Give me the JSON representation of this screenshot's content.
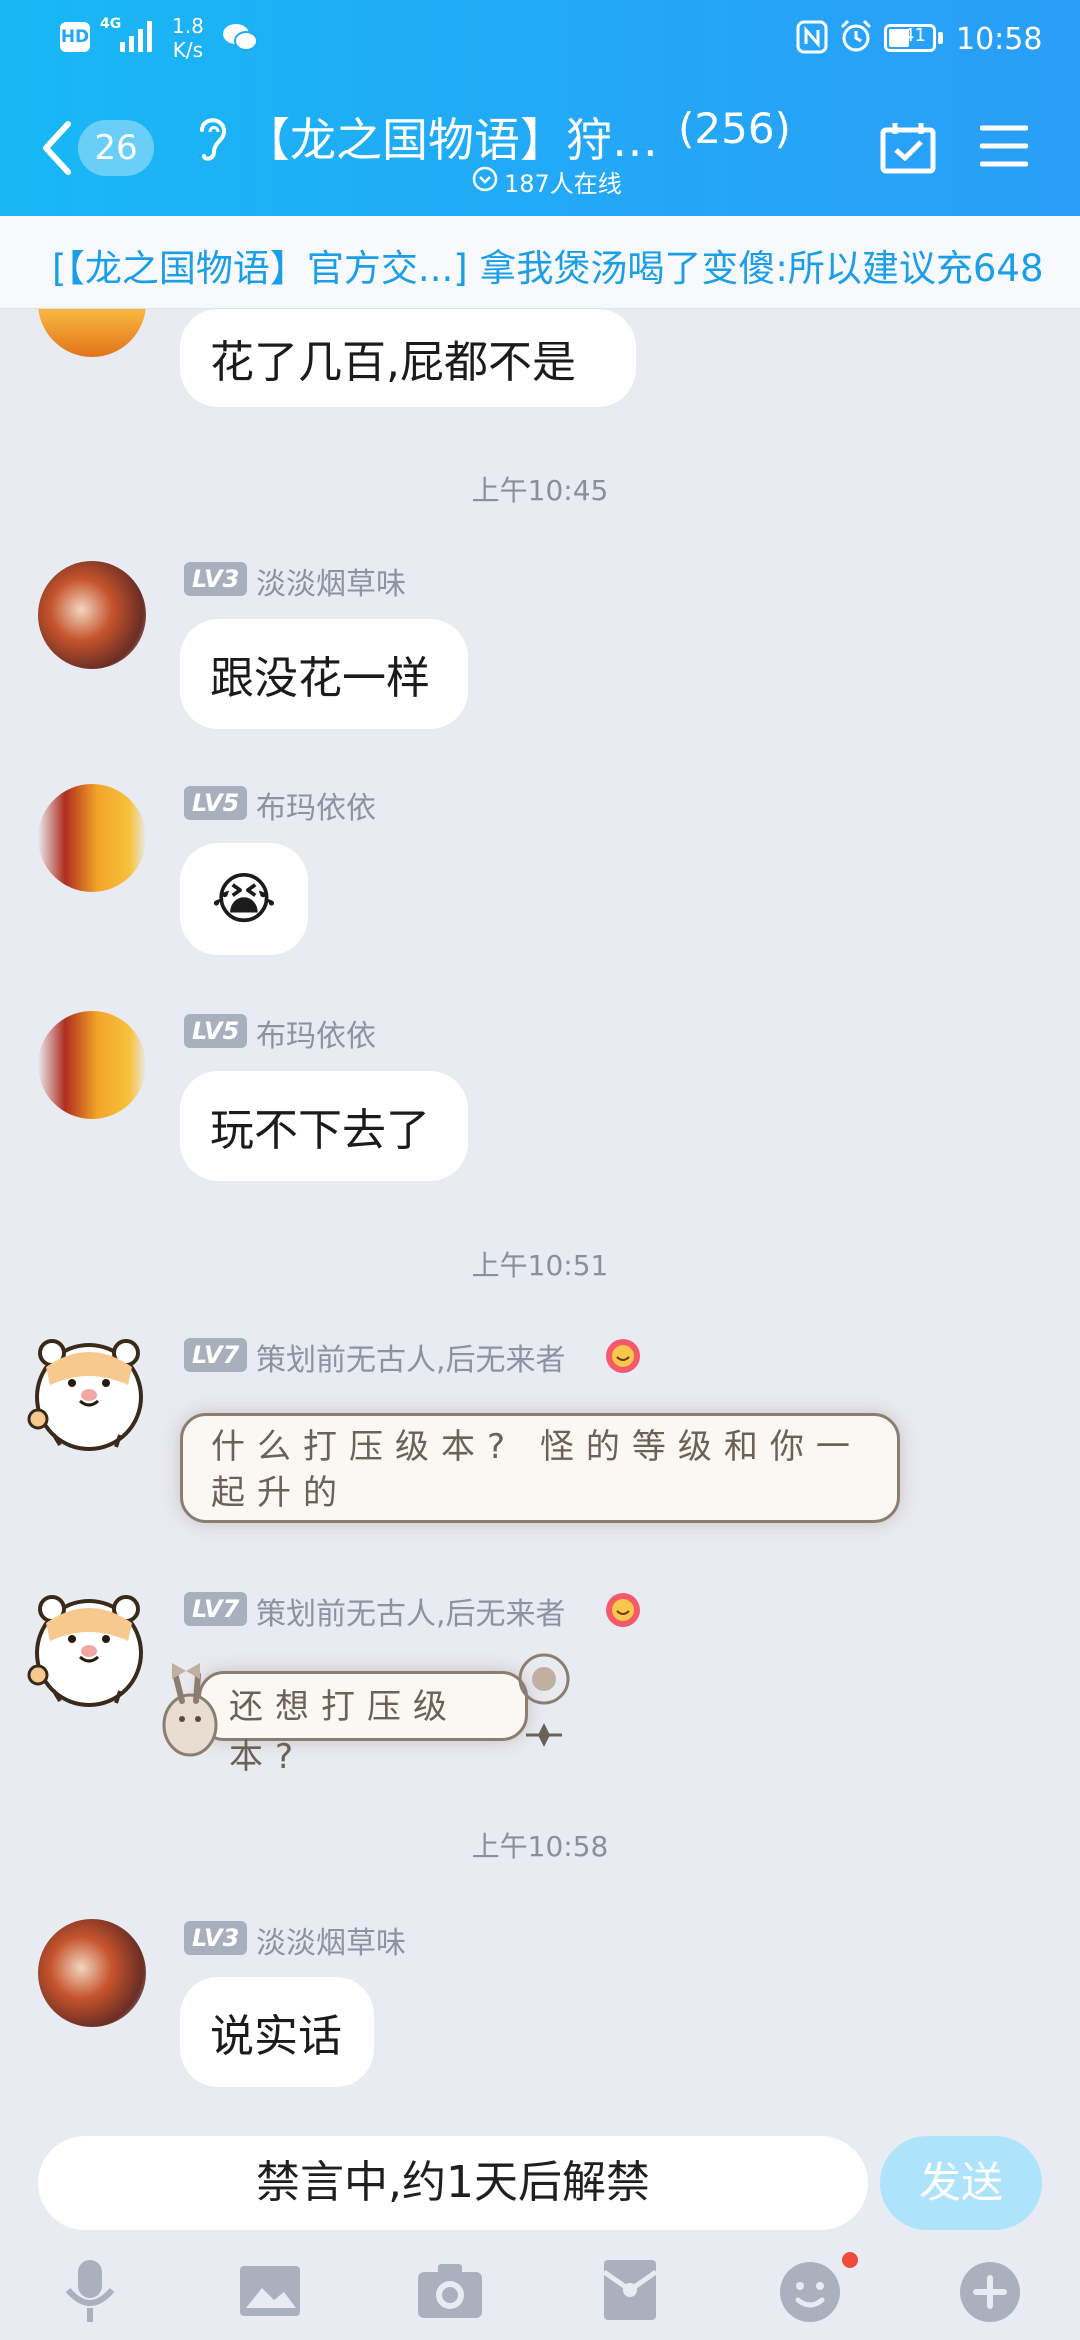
{
  "status_bar": {
    "net_speed_value": "1.8",
    "net_speed_unit": "K/s",
    "network": "4G",
    "hd": "HD",
    "battery": "41",
    "time": "10:58"
  },
  "header": {
    "unread_count": "26",
    "title": "【龙之国物语】狩…",
    "member_count": "(256)",
    "online": "187人在线"
  },
  "announcement": "[【龙之国物语】官方交...] 拿我煲汤喝了变傻:所以建议充648",
  "messages": {
    "partial_text": "花了几百,屁都不是",
    "time1": "上午10:45",
    "m1": {
      "level": "LV3",
      "name": "淡淡烟草味",
      "text": "跟没花一样"
    },
    "m2": {
      "level": "LV5",
      "name": "布玛依依",
      "text": "😭"
    },
    "m3": {
      "level": "LV5",
      "name": "布玛依依",
      "text": "玩不下去了"
    },
    "time2": "上午10:51",
    "m4": {
      "level": "LV7",
      "name": "策划前无古人,后无来者",
      "text_line1": "什么打压级本? 怪的等级和你一",
      "text_line2": "起升的"
    },
    "m5": {
      "level": "LV7",
      "name": "策划前无古人,后无来者",
      "text": "还想打压级本?"
    },
    "time3": "上午10:58",
    "m6": {
      "level": "LV3",
      "name": "淡淡烟草味",
      "text": "说实话"
    }
  },
  "input": {
    "muted_text": "禁言中,约1天后解禁",
    "send_label": "发送"
  },
  "colors": {
    "header": "#23a8f7",
    "chat_bg": "#e9ebf2",
    "announce_text": "#1b9ee8",
    "send_button": "#aee4fb",
    "badge_dot": "#f04a3a"
  }
}
